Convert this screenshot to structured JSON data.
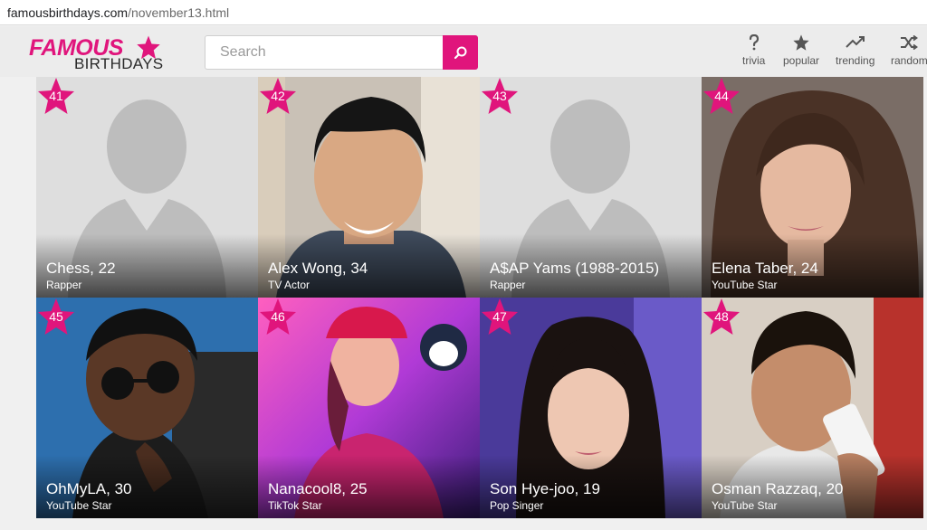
{
  "browser": {
    "url_domain": "famousbirthdays.com",
    "url_path": "/november13.html"
  },
  "header": {
    "logo_top": "FAMOUS",
    "logo_bottom": "BIRTHDAYS",
    "search_placeholder": "Search",
    "nav": [
      {
        "label": "trivia",
        "icon": "question-icon"
      },
      {
        "label": "popular",
        "icon": "star-icon"
      },
      {
        "label": "trending",
        "icon": "trending-icon"
      },
      {
        "label": "random",
        "icon": "shuffle-icon"
      }
    ]
  },
  "tiles": [
    {
      "rank": "41",
      "name": "Chess, 22",
      "job": "Rapper",
      "photo": "placeholder-silhouette"
    },
    {
      "rank": "42",
      "name": "Alex Wong, 34",
      "job": "TV Actor",
      "photo": "portrait"
    },
    {
      "rank": "43",
      "name": "A$AP Yams (1988-2015)",
      "job": "Rapper",
      "photo": "placeholder-silhouette"
    },
    {
      "rank": "44",
      "name": "Elena Taber, 24",
      "job": "YouTube Star",
      "photo": "portrait"
    },
    {
      "rank": "45",
      "name": "OhMyLA, 30",
      "job": "YouTube Star",
      "photo": "portrait"
    },
    {
      "rank": "46",
      "name": "Nanacool8, 25",
      "job": "TikTok Star",
      "photo": "illustration"
    },
    {
      "rank": "47",
      "name": "Son Hye-joo, 19",
      "job": "Pop Singer",
      "photo": "portrait"
    },
    {
      "rank": "48",
      "name": "Osman Razzaq, 20",
      "job": "YouTube Star",
      "photo": "portrait"
    }
  ],
  "colors": {
    "brand": "#e0157c"
  }
}
